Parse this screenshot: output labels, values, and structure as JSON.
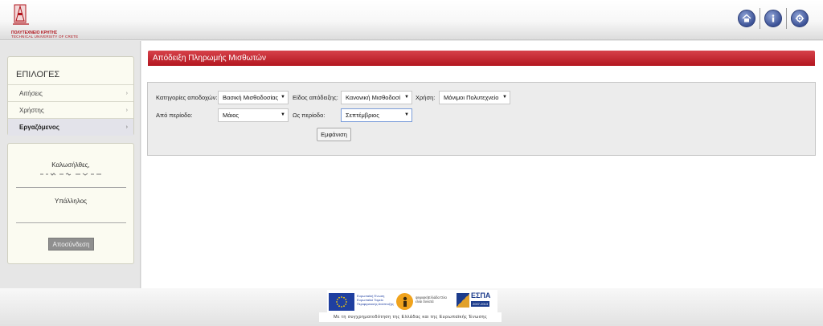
{
  "header": {
    "logo_line1": "ΠΟΛΥΤΕΧΝΕΙΟ ΚΡΗΤΗΣ",
    "logo_line2": "TECHNICAL UNIVERSITY OF CRETE",
    "icons": [
      "home-icon",
      "info-icon",
      "settings-icon"
    ]
  },
  "sidebar": {
    "menu_title": "ΕΠΙΛΟΓΕΣ",
    "items": [
      {
        "label": "Αιτήσεις",
        "active": false
      },
      {
        "label": "Χρήστης",
        "active": false
      },
      {
        "label": "Εργαζόμενος",
        "active": true
      }
    ],
    "welcome": "Καλωσήλθες,",
    "username": "",
    "role": "Υπάλληλος",
    "logout_label": "Αποσύνδεση"
  },
  "main": {
    "title": "Απόδειξη Πληρωμής Μισθωτών",
    "form": {
      "category_label": "Κατηγορίες αποδοχών:",
      "category_value": "Βασική Μισθοδοσίας",
      "receipt_type_label": "Είδος απόδειξης:",
      "receipt_type_value": "Κανονική Μισθοδοσί",
      "usage_label": "Χρήση:",
      "usage_value": "Μόνιμοι Πολυτεχνείο",
      "from_label": "Από περίοδο:",
      "from_value": "Μάιος",
      "to_label": "Ως περίοδο:",
      "to_value": "Σεπτέμβριος",
      "show_button": "Εμφάνιση"
    }
  },
  "footer": {
    "eu_text": "Ευρωπαϊκή Ένωση Ευρωπαϊκό Ταμείο Περιφερειακής Ανάπτυξης",
    "digital_text": "ψηφιακήΕλλάδα Όλα είναι δυνατά",
    "espa_name": "ΕΣΠΑ",
    "espa_years": "2007-2013",
    "cofund_text": "Με τη συγχρηματοδότηση της Ελλάδας και της Ευρωπαϊκής Ένωσης"
  },
  "colors": {
    "accent_red": "#c0262e",
    "panel_bg": "#fbfbf1",
    "header_icon_blue": "#3c5296"
  }
}
